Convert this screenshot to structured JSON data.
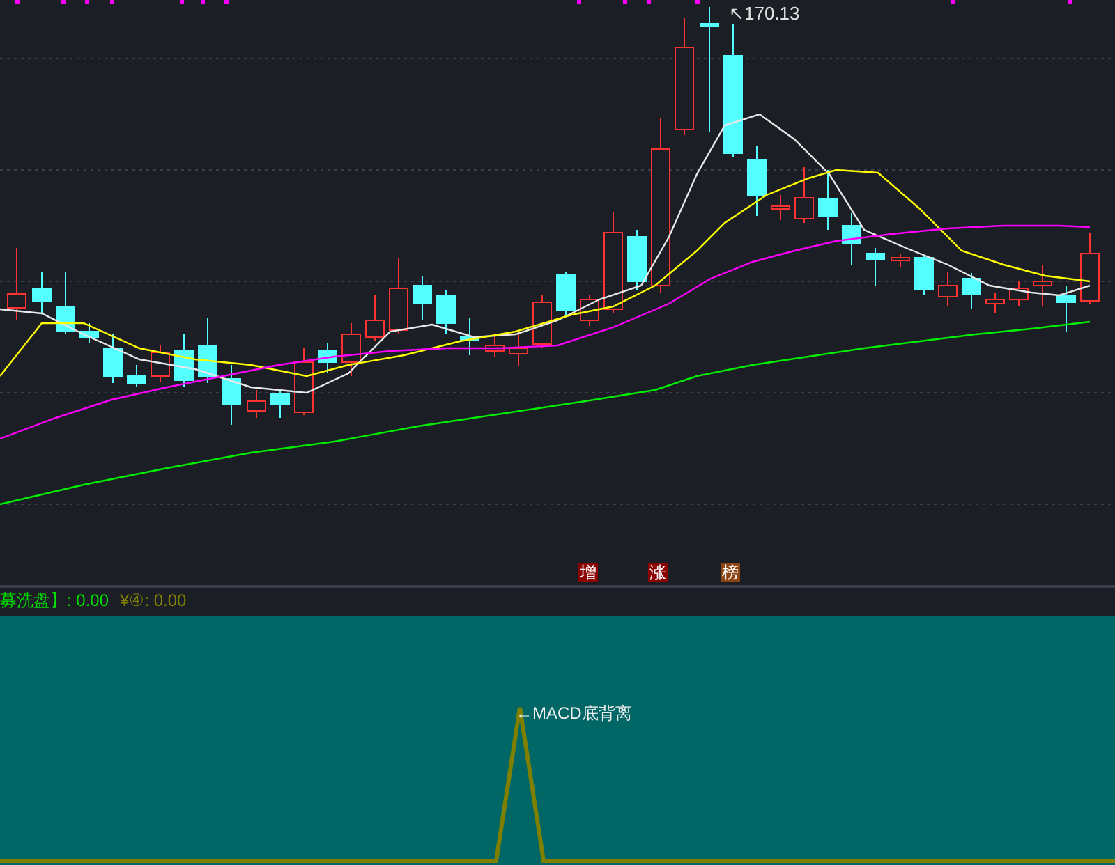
{
  "price_panel": {
    "high_label": "↖170.13",
    "markers": [
      {
        "text": "增",
        "color": "#8b0000"
      },
      {
        "text": "涨",
        "color": "#8b0000"
      },
      {
        "text": "榜",
        "color": "#8b4513"
      }
    ]
  },
  "indicator_panel": {
    "legend": [
      {
        "text": "募洗盘】: 0.00",
        "color": "#00e000"
      },
      {
        "text": "¥④: 0.00",
        "color": "#808000"
      }
    ],
    "signal_label": "←MACD底背离"
  }
}
